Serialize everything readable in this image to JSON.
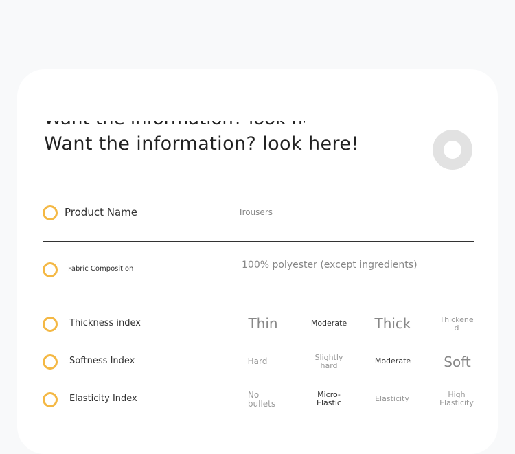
{
  "header": {
    "cut_text": "Want the information? look here",
    "title": "Want the information? look here!"
  },
  "rows": {
    "product_name": {
      "label": "Product Name",
      "value": "Trousers"
    },
    "fabric_composition": {
      "label": "Fabric Composition",
      "value": "100% polyester (except ingredients)"
    }
  },
  "indices": {
    "thickness": {
      "label": "Thickness index",
      "options": [
        "Thin",
        "Moderate",
        "Thick",
        "Thickene\nd"
      ],
      "selected": "Thick"
    },
    "softness": {
      "label": "Softness Index",
      "options": [
        "Hard",
        "Slightly\nhard",
        "Moderate",
        "Soft"
      ],
      "selected": "Moderate"
    },
    "elasticity": {
      "label": "Elasticity Index",
      "options": [
        "No\nbullets",
        "Micro-\nElastic",
        "Elasticity",
        "High\nElasticity"
      ],
      "selected": "Micro-Elastic"
    }
  },
  "colors": {
    "accent": "#f4b844",
    "card": "#ffffff",
    "background": "#f8f9fa"
  }
}
